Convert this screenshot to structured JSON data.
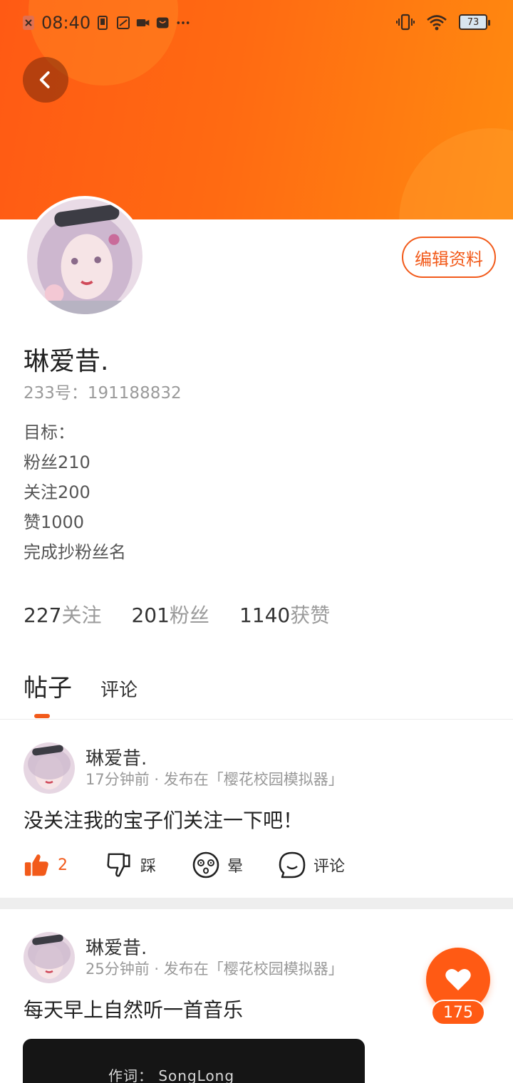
{
  "status_bar": {
    "time": "08:40",
    "battery": "73"
  },
  "profile": {
    "name": "琳爱昔.",
    "id_text": "233号：191188832",
    "bio_lines": [
      "目标：",
      "粉丝210",
      "关注200",
      "赞1000",
      "完成抄粉丝名"
    ],
    "edit_label": "编辑资料"
  },
  "stats": [
    {
      "num": "227",
      "label": "关注"
    },
    {
      "num": "201",
      "label": "粉丝"
    },
    {
      "num": "1140",
      "label": "获赞"
    }
  ],
  "tabs": {
    "posts": "帖子",
    "comments": "评论"
  },
  "posts": [
    {
      "author": "琳爱昔.",
      "meta": "17分钟前 · 发布在「樱花校园模拟器」",
      "text": "没关注我的宝子们关注一下吧！",
      "like_count": "2",
      "dislike_label": "踩",
      "dizzy_label": "晕",
      "comment_label": "评论"
    },
    {
      "author": "琳爱昔.",
      "meta": "25分钟前 · 发布在「樱花校园模拟器」",
      "text": "每天早上自然听一首音乐",
      "media_text": "作词： SongLong"
    }
  ],
  "floating_like": {
    "count": "175"
  },
  "colors": {
    "accent": "#f25a1a",
    "header_start": "#ff5a14",
    "header_end": "#ff8a10"
  }
}
